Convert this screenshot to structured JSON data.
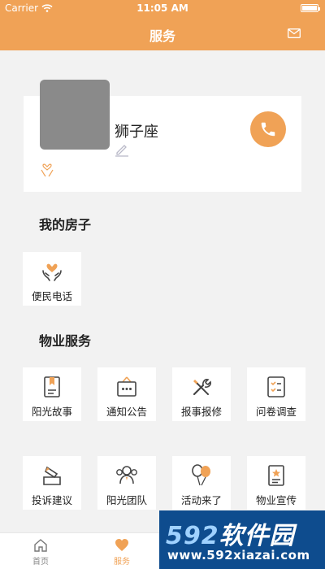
{
  "status_bar": {
    "carrier": "Carrier",
    "time": "11:05 AM"
  },
  "nav": {
    "title": "服务"
  },
  "profile": {
    "name": "狮子座"
  },
  "my_house": {
    "title": "我的房子",
    "items": [
      {
        "label": "便民电话",
        "icon": "heart-hands-icon"
      }
    ]
  },
  "property_services": {
    "title": "物业服务",
    "items": [
      {
        "label": "阳光故事",
        "icon": "bookmark-doc-icon"
      },
      {
        "label": "通知公告",
        "icon": "notice-board-icon"
      },
      {
        "label": "报事报修",
        "icon": "wrench-screwdriver-icon"
      },
      {
        "label": "问卷调查",
        "icon": "checklist-icon"
      },
      {
        "label": "投诉建议",
        "icon": "pen-paper-icon"
      },
      {
        "label": "阳光团队",
        "icon": "team-icon"
      },
      {
        "label": "活动来了",
        "icon": "balloons-icon"
      },
      {
        "label": "物业宣传",
        "icon": "star-doc-icon"
      }
    ]
  },
  "tab_bar": {
    "items": [
      {
        "label": "首页",
        "icon": "home-icon",
        "active": false
      },
      {
        "label": "服务",
        "icon": "heart-icon",
        "active": true
      }
    ]
  },
  "watermark": {
    "brand_num": "592",
    "brand_text": "软件园",
    "url": "www.592xiazai.com"
  },
  "colors": {
    "accent": "#f0a256",
    "background": "#f2f2f2",
    "watermark_bg": "#0e4c8e"
  }
}
